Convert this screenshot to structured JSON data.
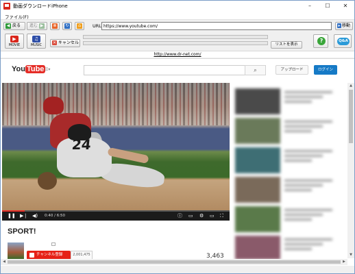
{
  "window": {
    "title": "動画ダウンロードiPhone",
    "controls": {
      "minimize": "–",
      "maximize": "☐",
      "close": "✕"
    }
  },
  "menu": {
    "items": [
      {
        "label": "ファイル(F)"
      }
    ]
  },
  "navbar": {
    "back_label": "戻る",
    "forward_label": "進む",
    "url_label": "URL:",
    "url_value": "https://www.youtube.com/",
    "go_label": "移動"
  },
  "toolbar": {
    "movie_label": "MOVIE",
    "music_label": "MUSIC",
    "cancel_label": "キャンセル",
    "list_label": "リストを表示",
    "help_symbol": "?",
    "qa_symbol": "Q&A"
  },
  "link": {
    "text": "http://www.dr-net.com/"
  },
  "youtube": {
    "logo_you": "You",
    "logo_tube": "Tube",
    "upload_label": "アップロード",
    "login_label": "ログイン",
    "player": {
      "time": "0:40 / 6:50",
      "progress": 0.1,
      "jersey_number": "24"
    },
    "video": {
      "title": "SPORT!",
      "subscribe_label": "チャンネル登録",
      "subscriber_count": "2,001,475",
      "views": "3,463"
    },
    "sidebar_thumb_colors": [
      "#4a4a4a",
      "#6a7a5a",
      "#3e6e74",
      "#7a6a5a",
      "#5a7a4a",
      "#8a5a6a"
    ]
  },
  "colors": {
    "youtube_red": "#e52d27",
    "login_blue": "#167ac6",
    "help_green": "#3aa63a",
    "qa_blue": "#2a9ad8"
  }
}
